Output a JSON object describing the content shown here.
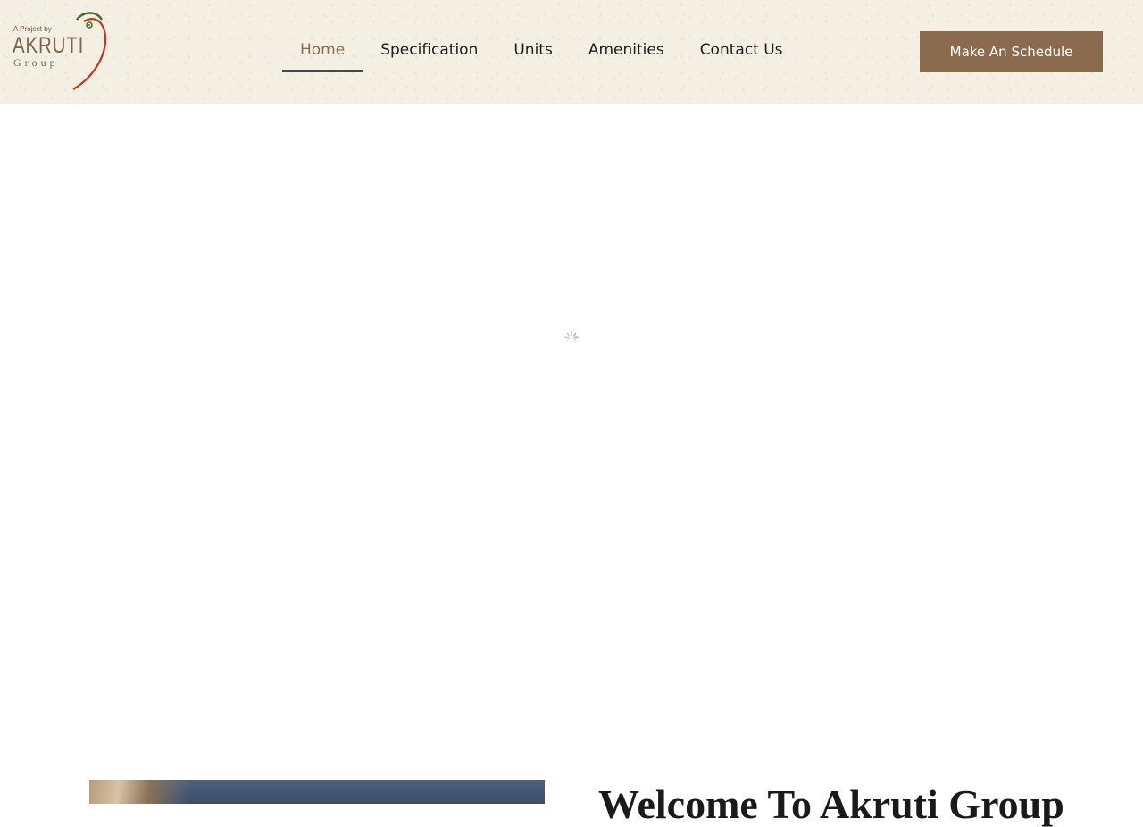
{
  "logo": {
    "tagline": "A Project by",
    "name": "AKRUTI",
    "group": "Group"
  },
  "nav": {
    "items": [
      {
        "label": "Home",
        "active": true
      },
      {
        "label": "Specification",
        "active": false
      },
      {
        "label": "Units",
        "active": false
      },
      {
        "label": "Amenities",
        "active": false
      },
      {
        "label": "Contact Us",
        "active": false
      }
    ]
  },
  "cta": {
    "label": "Make An Schedule"
  },
  "welcome": {
    "heading": "Welcome To Akruti Group"
  },
  "colors": {
    "brand": "#8b6b4e",
    "header_bg": "#f3efe3",
    "active_underline": "#4a4a4a",
    "logo_arc_red": "#c8331f",
    "logo_arc_green": "#4d6b2e"
  },
  "icons": {
    "loader": "spinner-icon"
  }
}
